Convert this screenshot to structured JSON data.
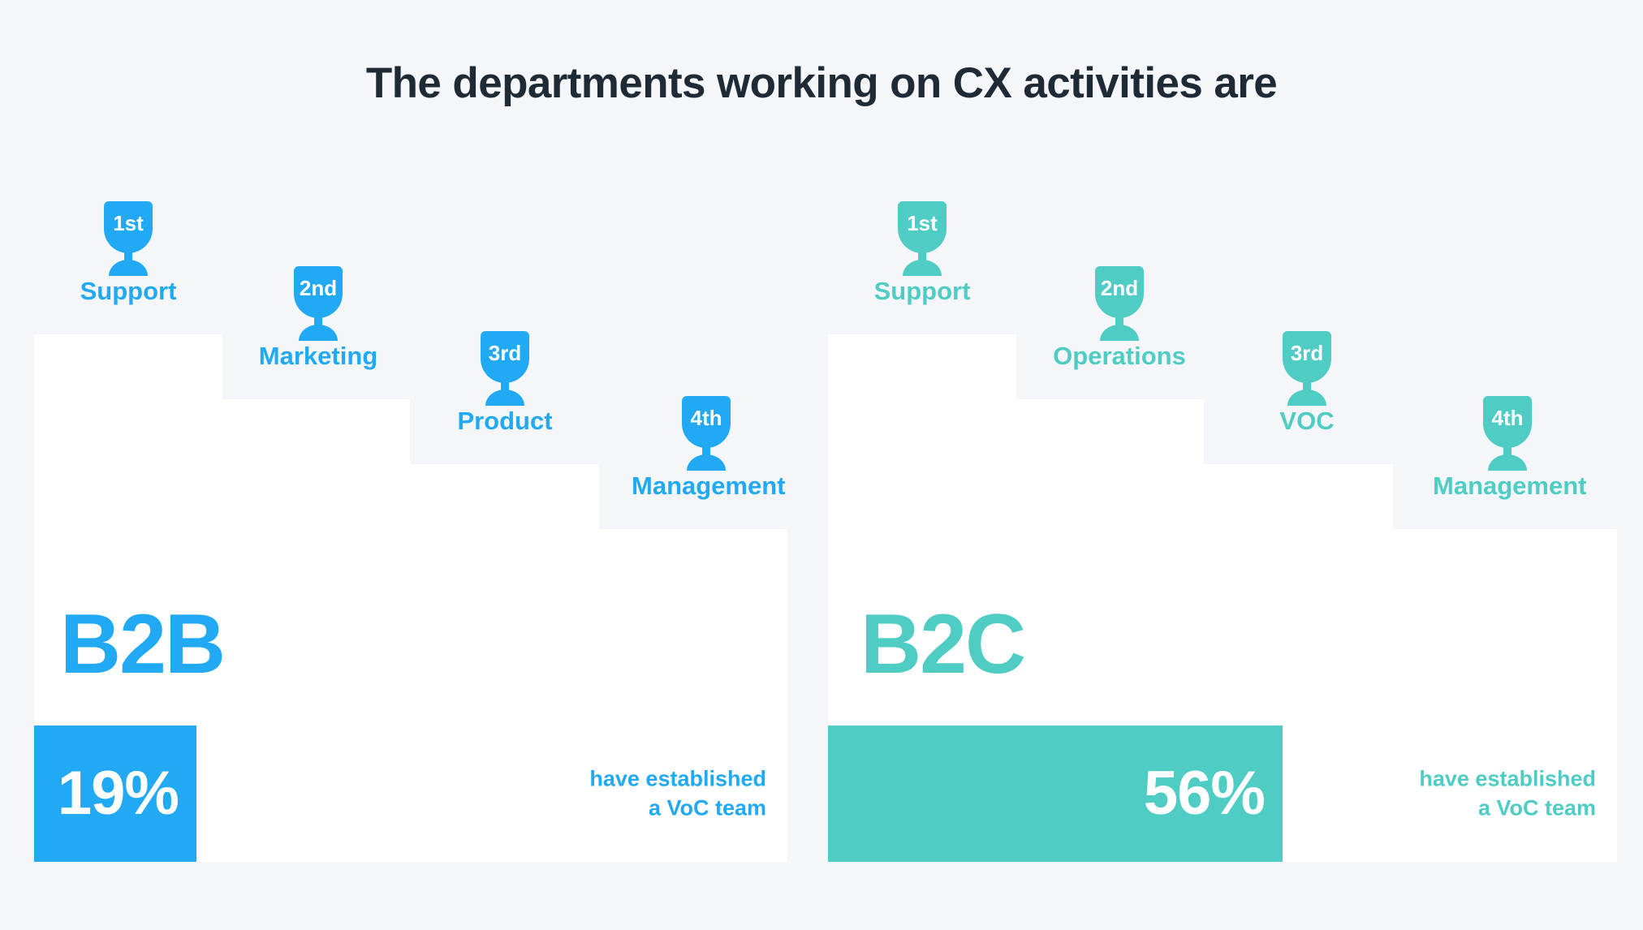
{
  "title": "The departments working on CX activities are",
  "colors": {
    "background": "#f4f6f9",
    "card": "#ffffff",
    "title": "#1f2a37",
    "b2b_accent": "#21a9f3",
    "b2c_accent": "#4fccc4"
  },
  "segments": [
    {
      "id": "b2b",
      "name": "B2B",
      "accent": "#21a9f3",
      "departments": [
        {
          "rank": "1st",
          "label": "Support"
        },
        {
          "rank": "2nd",
          "label": "Marketing"
        },
        {
          "rank": "3rd",
          "label": "Product"
        },
        {
          "rank": "4th",
          "label": "Management"
        }
      ],
      "stat": {
        "percent": "19%",
        "value": 19,
        "caption_line1": "have established",
        "caption_line2": "a VoC team"
      }
    },
    {
      "id": "b2c",
      "name": "B2C",
      "accent": "#4fccc4",
      "departments": [
        {
          "rank": "1st",
          "label": "Support"
        },
        {
          "rank": "2nd",
          "label": "Operations"
        },
        {
          "rank": "3rd",
          "label": "VOC"
        },
        {
          "rank": "4th",
          "label": "Management"
        }
      ],
      "stat": {
        "percent": "56%",
        "value": 56,
        "caption_line1": "have established",
        "caption_line2": "a VoC team"
      }
    }
  ],
  "chart_data": {
    "type": "bar",
    "title": "The departments working on CX activities are",
    "xlabel": "",
    "ylabel": "",
    "categories": [
      "B2B",
      "B2C"
    ],
    "series": [
      {
        "name": "have established a VoC team (%)",
        "values": [
          19,
          56
        ]
      }
    ],
    "ylim": [
      0,
      100
    ],
    "grid": false,
    "legend": "none",
    "annotations": [
      "B2B ranking: 1st Support, 2nd Marketing, 3rd Product, 4th Management",
      "B2C ranking: 1st Support, 2nd Operations, 3rd VOC, 4th Management"
    ]
  }
}
